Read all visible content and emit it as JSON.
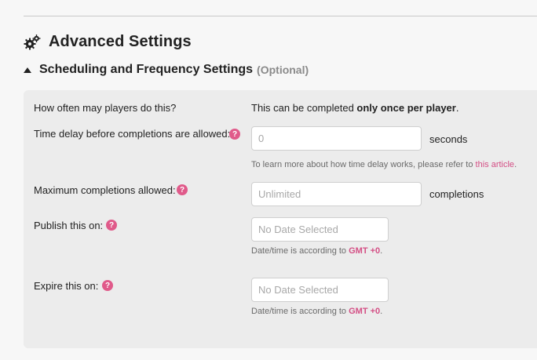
{
  "advanced": {
    "title": "Advanced Settings",
    "icon": "gears-icon"
  },
  "scheduling": {
    "title": "Scheduling and Frequency Settings",
    "optional": "(Optional)"
  },
  "rows": {
    "frequency": {
      "label": "How often may players do this?",
      "value_pre": "This can be completed ",
      "value_bold": "only once per player",
      "value_post": "."
    },
    "delay": {
      "label": "Time delay before completions are allowed:",
      "placeholder": "0",
      "unit": "seconds",
      "note_pre": "To learn more about how time delay works, please refer to ",
      "note_link": "this article",
      "note_post": "."
    },
    "max": {
      "label": "Maximum completions allowed:",
      "placeholder": "Unlimited",
      "unit": "completions"
    },
    "publish": {
      "label": "Publish this on:",
      "placeholder": "No Date Selected",
      "note_pre": "Date/time is according to ",
      "note_gmt": "GMT +0",
      "note_post": "."
    },
    "expire": {
      "label": "Expire this on:",
      "placeholder": "No Date Selected",
      "note_pre": "Date/time is according to ",
      "note_gmt": "GMT +0",
      "note_post": "."
    }
  },
  "help_glyph": "?",
  "colors": {
    "accent": "#e05a8a",
    "link": "#d44f85",
    "panel": "#ececec",
    "background": "#f7f7f7"
  }
}
